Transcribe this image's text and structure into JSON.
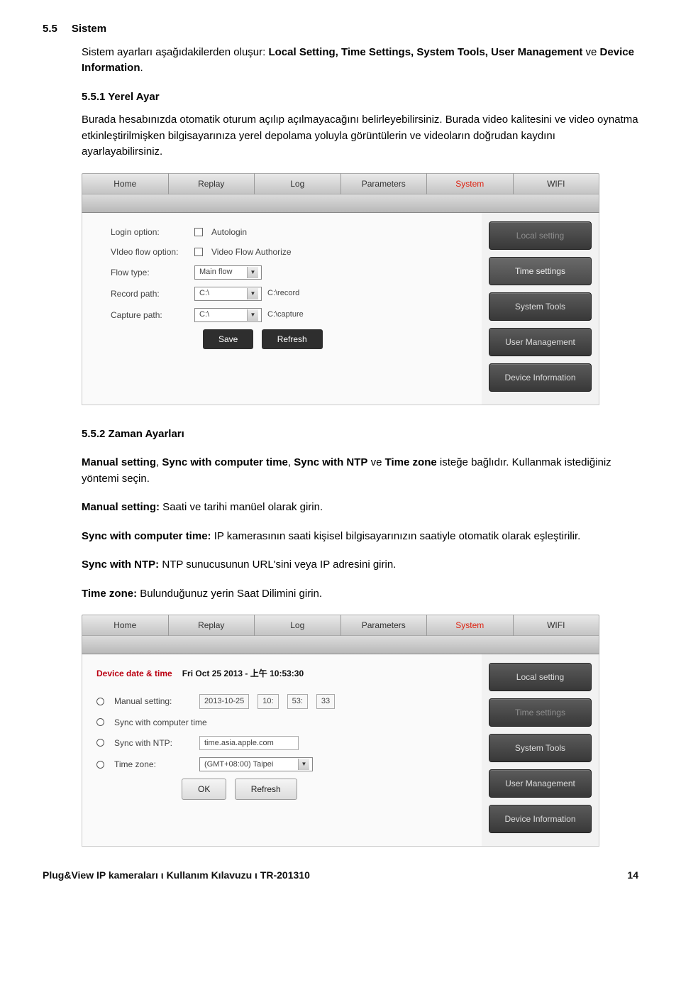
{
  "doc": {
    "section_num": "5.5",
    "section_title": "Sistem",
    "intro_a": "Sistem ayarları aşağıdakilerden oluşur: ",
    "intro_bold": "Local Setting, Time Settings, System Tools, User Management",
    "intro_b": " ve ",
    "intro_bold2": "Device Information",
    "intro_end": ".",
    "sub1_num": "5.5.1 Yerel Ayar",
    "sub1_text": "Burada hesabınızda otomatik oturum açılıp açılmayacağını belirleyebilirsiniz. Burada video kalitesini ve video oynatma etkinleştirilmişken bilgisayarınıza yerel depolama yoluyla görüntülerin ve videoların doğrudan kaydını ayarlayabilirsiniz.",
    "sub2_num": "5.5.2 Zaman Ayarları",
    "sub2_p1_a": "Manual setting",
    "sub2_p1_b": ", ",
    "sub2_p1_c": "Sync with computer time",
    "sub2_p1_d": ", ",
    "sub2_p1_e": "Sync with NTP",
    "sub2_p1_f": " ve ",
    "sub2_p1_g": "Time zone",
    "sub2_p1_h": " isteğe bağlıdır. Kullanmak istediğiniz yöntemi seçin.",
    "sub2_p2_a": "Manual setting:",
    "sub2_p2_b": " Saati ve tarihi manüel olarak girin.",
    "sub2_p3_a": "Sync with computer time:",
    "sub2_p3_b": " IP kamerasının saati kişisel bilgisayarınızın saatiyle otomatik olarak eşleştirilir.",
    "sub2_p4_a": "Sync with NTP:",
    "sub2_p4_b": " NTP sunucusunun URL'sini veya IP adresini girin.",
    "sub2_p5_a": "Time zone:",
    "sub2_p5_b": " Bulunduğunuz yerin Saat Dilimini girin.",
    "footer_left": "Plug&View IP kameraları ι Kullanım Kılavuzu ι TR-201310",
    "footer_right": "14"
  },
  "tabs": {
    "home": "Home",
    "replay": "Replay",
    "log": "Log",
    "parameters": "Parameters",
    "system": "System",
    "wifi": "WIFI"
  },
  "side": {
    "local": "Local setting",
    "time": "Time settings",
    "tools": "System Tools",
    "user": "User Management",
    "info": "Device Information"
  },
  "shot1": {
    "login_label": "Login option:",
    "autologin": "Autologin",
    "flowopt_label": "VIdeo flow option:",
    "flowauth": "Video Flow Authorize",
    "flowtype_label": "Flow type:",
    "flowtype_val": "Main flow",
    "record_label": "Record path:",
    "record_sel": "C:\\",
    "record_path": "C:\\record",
    "capture_label": "Capture path:",
    "capture_sel": "C:\\",
    "capture_path": "C:\\capture",
    "save": "Save",
    "refresh": "Refresh"
  },
  "shot2": {
    "dt_label": "Device date & time",
    "dt_value": "Fri Oct 25 2013 - 上午 10:53:30",
    "manual_label": "Manual setting:",
    "manual_date": "2013-10-25",
    "manual_h": "10:",
    "manual_m": "53:",
    "manual_s": "33",
    "sync_comp": "Sync with computer time",
    "sync_ntp": "Sync with NTP:",
    "ntp_val": "time.asia.apple.com",
    "tz_label": "Time zone:",
    "tz_val": "(GMT+08:00) Taipei",
    "ok": "OK",
    "refresh": "Refresh"
  }
}
